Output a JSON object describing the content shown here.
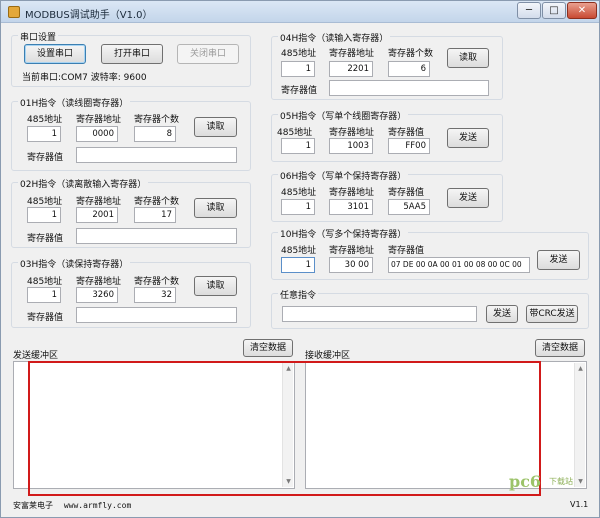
{
  "window": {
    "title": "MODBUS调试助手（V1.0）",
    "minimize": "─",
    "maximize": "□",
    "close": "✕"
  },
  "serial": {
    "title": "串口设置",
    "setup": "设置串口",
    "open": "打开串口",
    "close": "关闭串口",
    "status": "当前串口:COM7 波特率: 9600"
  },
  "f01": {
    "title": "01H指令（读线圈寄存器）",
    "col1": "485地址",
    "col2": "寄存器地址",
    "col3": "寄存器个数",
    "addr": "1",
    "reg": "0000",
    "count": "8",
    "read": "读取",
    "value_label": "寄存器值"
  },
  "f02": {
    "title": "02H指令（读离散输入寄存器）",
    "col1": "485地址",
    "col2": "寄存器地址",
    "col3": "寄存器个数",
    "addr": "1",
    "reg": "2001",
    "count": "17",
    "read": "读取",
    "value_label": "寄存器值"
  },
  "f03": {
    "title": "03H指令（读保持寄存器）",
    "col1": "485地址",
    "col2": "寄存器地址",
    "col3": "寄存器个数",
    "addr": "1",
    "reg": "3260",
    "count": "32",
    "read": "读取",
    "value_label": "寄存器值"
  },
  "f04": {
    "title": "04H指令（读输入寄存器）",
    "col1": "485地址",
    "col2": "寄存器地址",
    "col3": "寄存器个数",
    "addr": "1",
    "reg": "2201",
    "count": "6",
    "read": "读取",
    "value_label": "寄存器值"
  },
  "f05": {
    "title": "05H指令（写单个线圈寄存器）",
    "col1": "485地址",
    "col2": "寄存器地址",
    "col3": "寄存器值",
    "addr": "1",
    "reg": "1003",
    "val": "FF00",
    "send": "发送"
  },
  "f06": {
    "title": "06H指令（写单个保持寄存器）",
    "col1": "485地址",
    "col2": "寄存器地址",
    "col3": "寄存器值",
    "addr": "1",
    "reg": "3101",
    "val": "5AA5",
    "send": "发送"
  },
  "f10": {
    "title": "10H指令（写多个保持寄存器）",
    "col1": "485地址",
    "col2": "寄存器地址",
    "col3": "寄存器值",
    "addr": "1",
    "reg": "30 00",
    "val": "07 DE 00 0A 00 01 00 08 00 0C 00",
    "send": "发送"
  },
  "custom": {
    "title": "任意指令",
    "send": "发送",
    "send_crc": "带CRC发送"
  },
  "send_buffer": {
    "title": "发送缓冲区",
    "clear": "清空数据"
  },
  "recv_buffer": {
    "title": "接收缓冲区",
    "clear": "清空数据"
  },
  "footer": {
    "company": "安富莱电子",
    "url": "www.armfly.com",
    "version": "V1.1"
  },
  "watermark": {
    "logo": "pc6",
    "sub": "下载站"
  }
}
